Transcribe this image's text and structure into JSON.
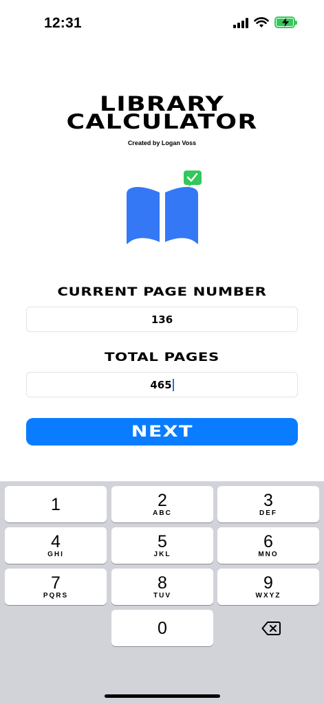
{
  "status_bar": {
    "time": "12:31"
  },
  "app": {
    "title_line1": "LIBRARY",
    "title_line2": "CALCULATOR",
    "subtitle": "Created by Logan Voss"
  },
  "form": {
    "current_label": "CURRENT PAGE NUMBER",
    "current_value": "136",
    "total_label": "TOTAL PAGES",
    "total_value": "465",
    "next_label": "NEXT"
  },
  "keyboard": {
    "keys": [
      {
        "digit": "1",
        "letters": ""
      },
      {
        "digit": "2",
        "letters": "ABC"
      },
      {
        "digit": "3",
        "letters": "DEF"
      },
      {
        "digit": "4",
        "letters": "GHI"
      },
      {
        "digit": "5",
        "letters": "JKL"
      },
      {
        "digit": "6",
        "letters": "MNO"
      },
      {
        "digit": "7",
        "letters": "PQRS"
      },
      {
        "digit": "8",
        "letters": "TUV"
      },
      {
        "digit": "9",
        "letters": "WXYZ"
      },
      {
        "digit": "0",
        "letters": ""
      }
    ],
    "delete_icon": "backspace-icon"
  },
  "colors": {
    "accent": "#0a7cff",
    "book": "#3478f6",
    "badge": "#34c759",
    "keyboard_bg": "#d1d3d9"
  }
}
